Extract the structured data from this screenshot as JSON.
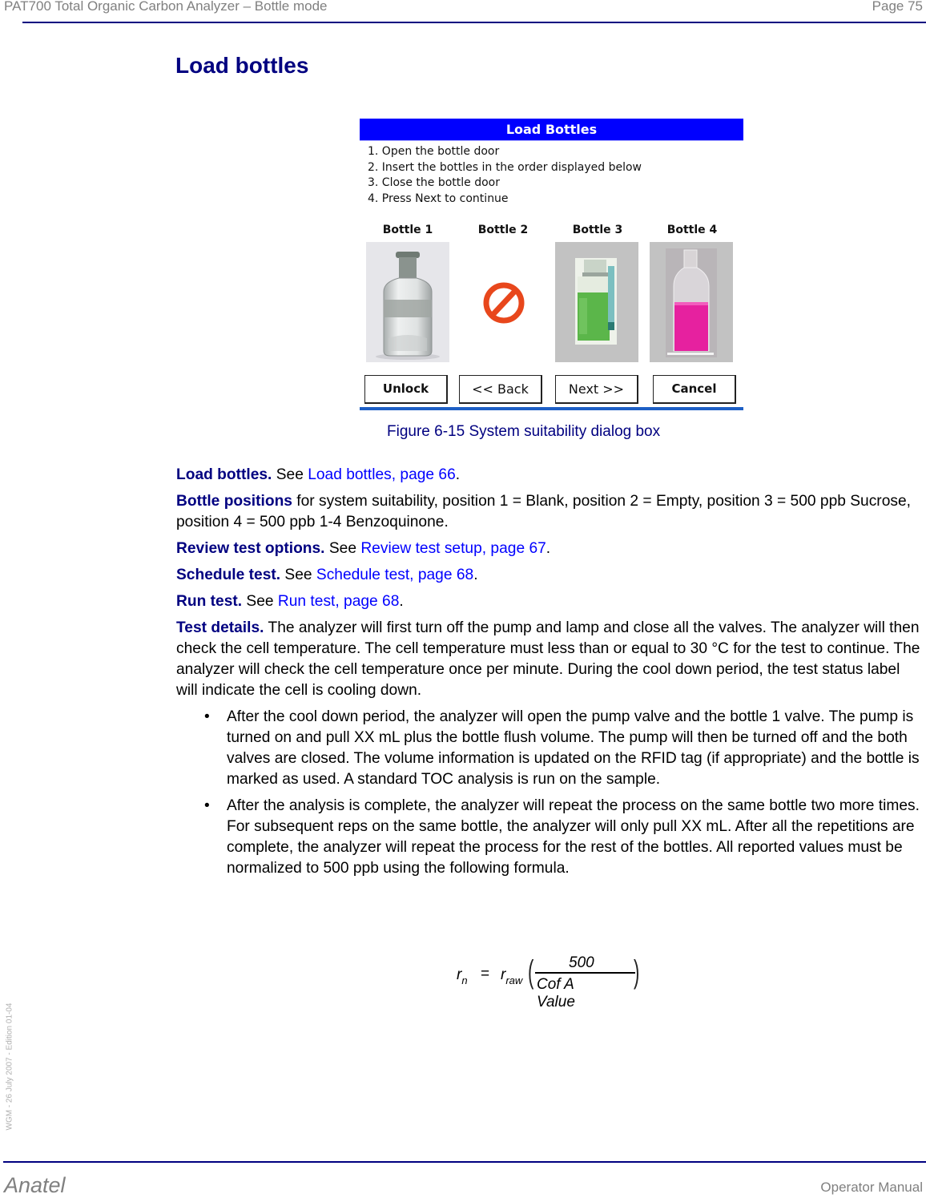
{
  "header": {
    "title": "PAT700 Total Organic Carbon Analyzer – Bottle mode",
    "page": "Page 75"
  },
  "page_title": "Load bottles",
  "dialog": {
    "title": "Load Bottles",
    "title_bar_color": "#0000ff",
    "steps": [
      "1. Open the bottle door",
      "2. Insert the bottles in the order displayed below",
      "3. Close the bottle door",
      "4. Press Next to continue"
    ],
    "bottles": [
      {
        "label": "Bottle 1",
        "image": "clear-glass-bottle"
      },
      {
        "label": "Bottle 2",
        "image": "prohibited-icon"
      },
      {
        "label": "Bottle 3",
        "image": "green-liquid-bottle"
      },
      {
        "label": "Bottle 4",
        "image": "pink-liquid-bottle"
      }
    ],
    "buttons": {
      "unlock": "Unlock",
      "back": "<< Back",
      "next": "Next >>",
      "cancel": "Cancel"
    }
  },
  "caption": "Figure 6-15 System suitability dialog box",
  "paragraphs": {
    "load_bottles": {
      "bold": "Load bottles.",
      "pre": " See ",
      "link": "Load bottles, page 66",
      "post": "."
    },
    "bottle_positions": {
      "bold": "Bottle positions",
      "text": " for system suitability, position 1 = Blank, position 2 = Empty, position 3 = 500 ppb Sucrose, position 4 = 500 ppb 1-4 Benzoquinone."
    },
    "review": {
      "bold": "Review test options.",
      "pre": " See ",
      "link": "Review test setup, page 67",
      "post": "."
    },
    "schedule": {
      "bold": "Schedule test.",
      "pre": " See ",
      "link": "Schedule test, page 68",
      "post": "."
    },
    "run": {
      "bold": "Run test.",
      "pre": " See ",
      "link": "Run test, page 68",
      "post": "."
    },
    "details": {
      "bold": "Test details.",
      "text": " The analyzer will first turn off the pump and lamp and close all the valves. The analyzer will then check the cell temperature. The cell temperature must less than or equal to 30 °C for the test to continue. The analyzer will check the cell temperature once per minute. During the cool down period, the test status label will indicate the cell is cooling down."
    }
  },
  "bullets": [
    "After the cool down period, the analyzer will open the pump valve and the bottle 1 valve. The pump is turned on and pull XX mL plus the bottle flush volume. The pump will then be turned off and the both valves are closed. The volume information is updated on the RFID tag (if appropriate) and the bottle is marked as used. A standard TOC analysis is run on the sample.",
    "After the analysis is complete, the analyzer will repeat the process on the same bottle two more times. For subsequent reps on the same bottle, the analyzer will only pull XX mL. After all the repetitions are complete, the analyzer will repeat the process for the rest of the bottles. All reported values must be normalized to 500 ppb using the following formula."
  ],
  "bullet_symbol": "•",
  "formula": {
    "lhs": "r",
    "lhs_sub": "n",
    "eq": "=",
    "rhs": "r",
    "rhs_sub": "raw",
    "numerator": "500",
    "denominator": "Cof A Value",
    "open_paren": "(",
    "close_paren": ")"
  },
  "side_note": "WGM - 26 July 2007 - Edition 01-04",
  "footer": {
    "brand": "Anatel",
    "manual": "Operator Manual"
  }
}
